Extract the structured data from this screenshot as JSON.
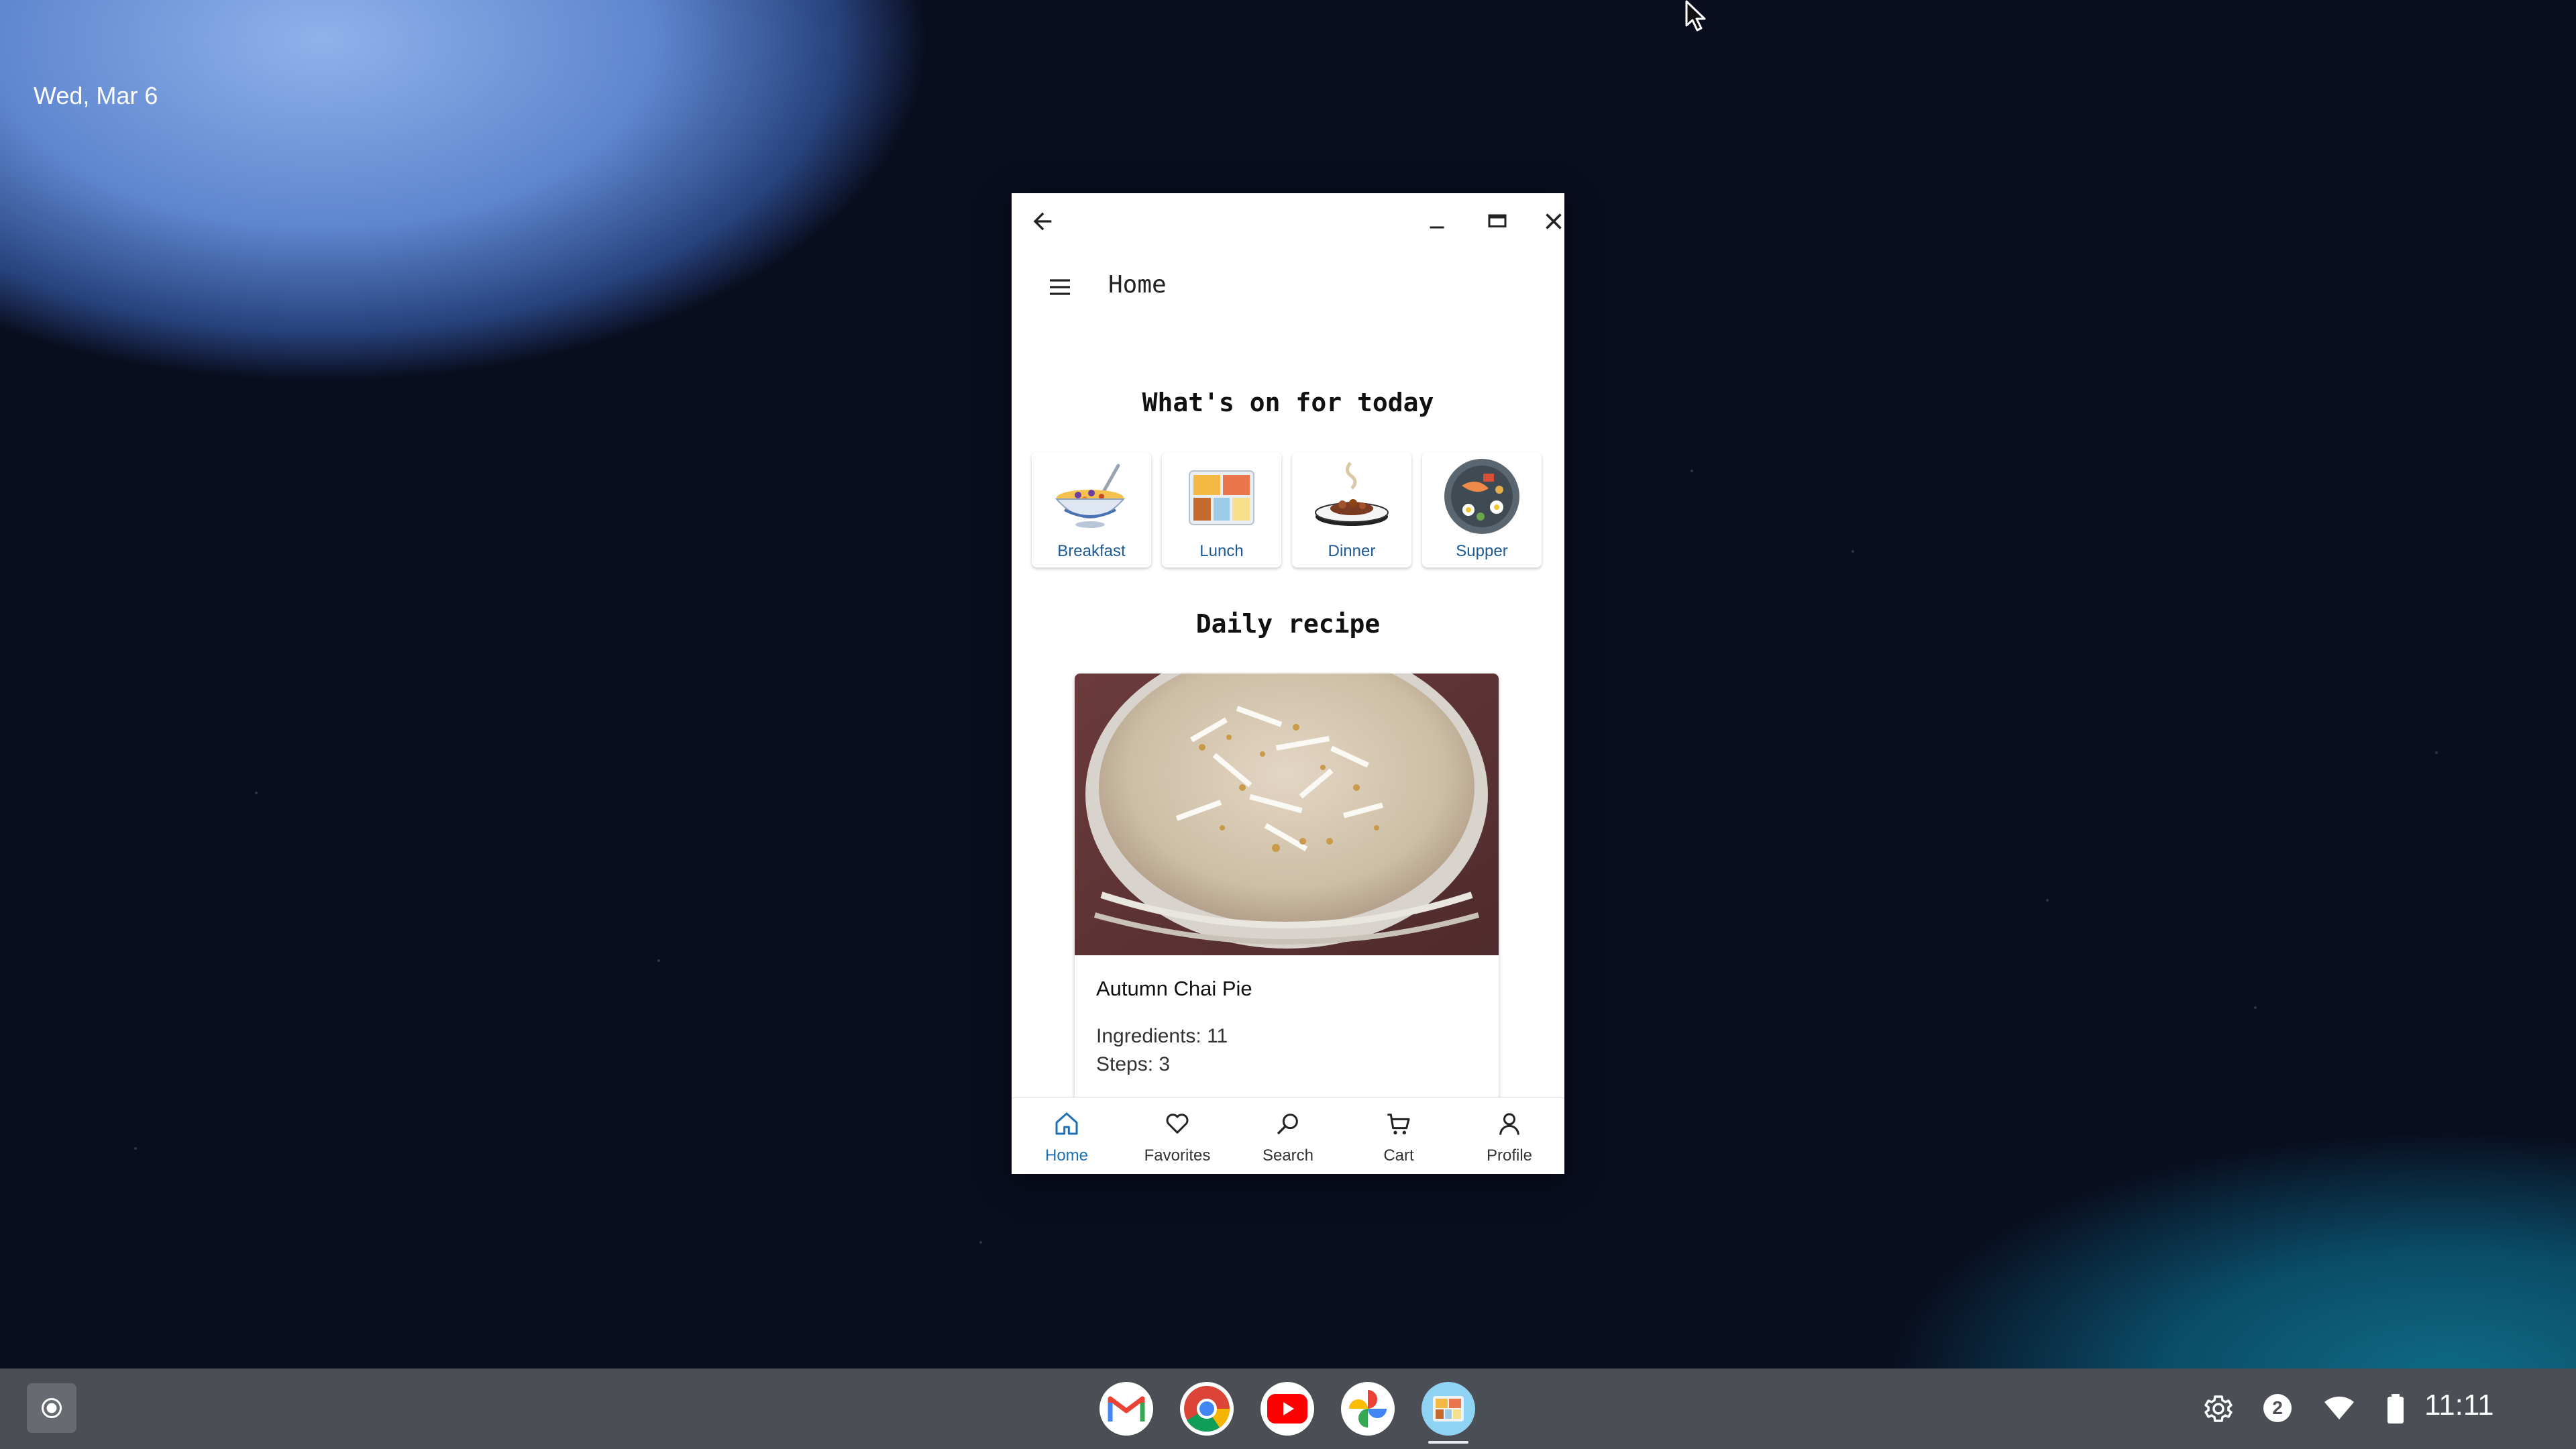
{
  "desktop": {
    "date": "Wed, Mar 6"
  },
  "window": {
    "app_bar_title": "Home",
    "section_today": "What's on for today",
    "meals": [
      {
        "label": "Breakfast",
        "icon": "cereal-bowl-icon"
      },
      {
        "label": "Lunch",
        "icon": "lunch-box-icon"
      },
      {
        "label": "Dinner",
        "icon": "dinner-plate-icon"
      },
      {
        "label": "Supper",
        "icon": "supper-platter-icon"
      }
    ],
    "section_daily": "Daily recipe",
    "recipe": {
      "name": "Autumn Chai Pie",
      "ingredients": "Ingredients: 11",
      "steps": "Steps: 3"
    },
    "bottom_nav": [
      {
        "label": "Home",
        "icon": "home-icon",
        "active": true
      },
      {
        "label": "Favorites",
        "icon": "heart-icon",
        "active": false
      },
      {
        "label": "Search",
        "icon": "search-icon",
        "active": false
      },
      {
        "label": "Cart",
        "icon": "cart-icon",
        "active": false
      },
      {
        "label": "Profile",
        "icon": "person-icon",
        "active": false
      }
    ],
    "accent_color": "#1e6fb3"
  },
  "shelf": {
    "apps": [
      "Gmail",
      "Chrome",
      "YouTube",
      "Photos",
      "Recipe app"
    ],
    "notification_count": "2",
    "clock": "11:11"
  }
}
